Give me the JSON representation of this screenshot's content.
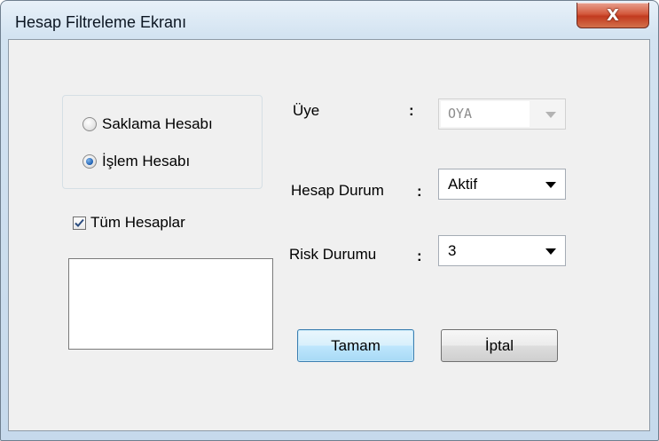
{
  "window": {
    "title": "Hesap Filtreleme Ekranı",
    "close_label": "X"
  },
  "account_type": {
    "options": [
      {
        "label": "Saklama Hesabı",
        "selected": false
      },
      {
        "label": "İşlem Hesabı",
        "selected": true
      }
    ]
  },
  "all_accounts": {
    "label": "Tüm Hesaplar",
    "checked": true
  },
  "fields": {
    "member": {
      "label": "Üye",
      "colon": ":",
      "value": "OYA",
      "enabled": false
    },
    "account_status": {
      "label": "Hesap Durum",
      "colon": ":",
      "value": "Aktif",
      "enabled": true
    },
    "risk_status": {
      "label": "Risk Durumu",
      "colon": ":",
      "value": "3",
      "enabled": true
    }
  },
  "buttons": {
    "ok": "Tamam",
    "cancel": "İptal"
  },
  "colors": {
    "client_bg": "#f0f0f0",
    "close_red": "#c23a1f",
    "default_button_border": "#3c7fb1"
  }
}
